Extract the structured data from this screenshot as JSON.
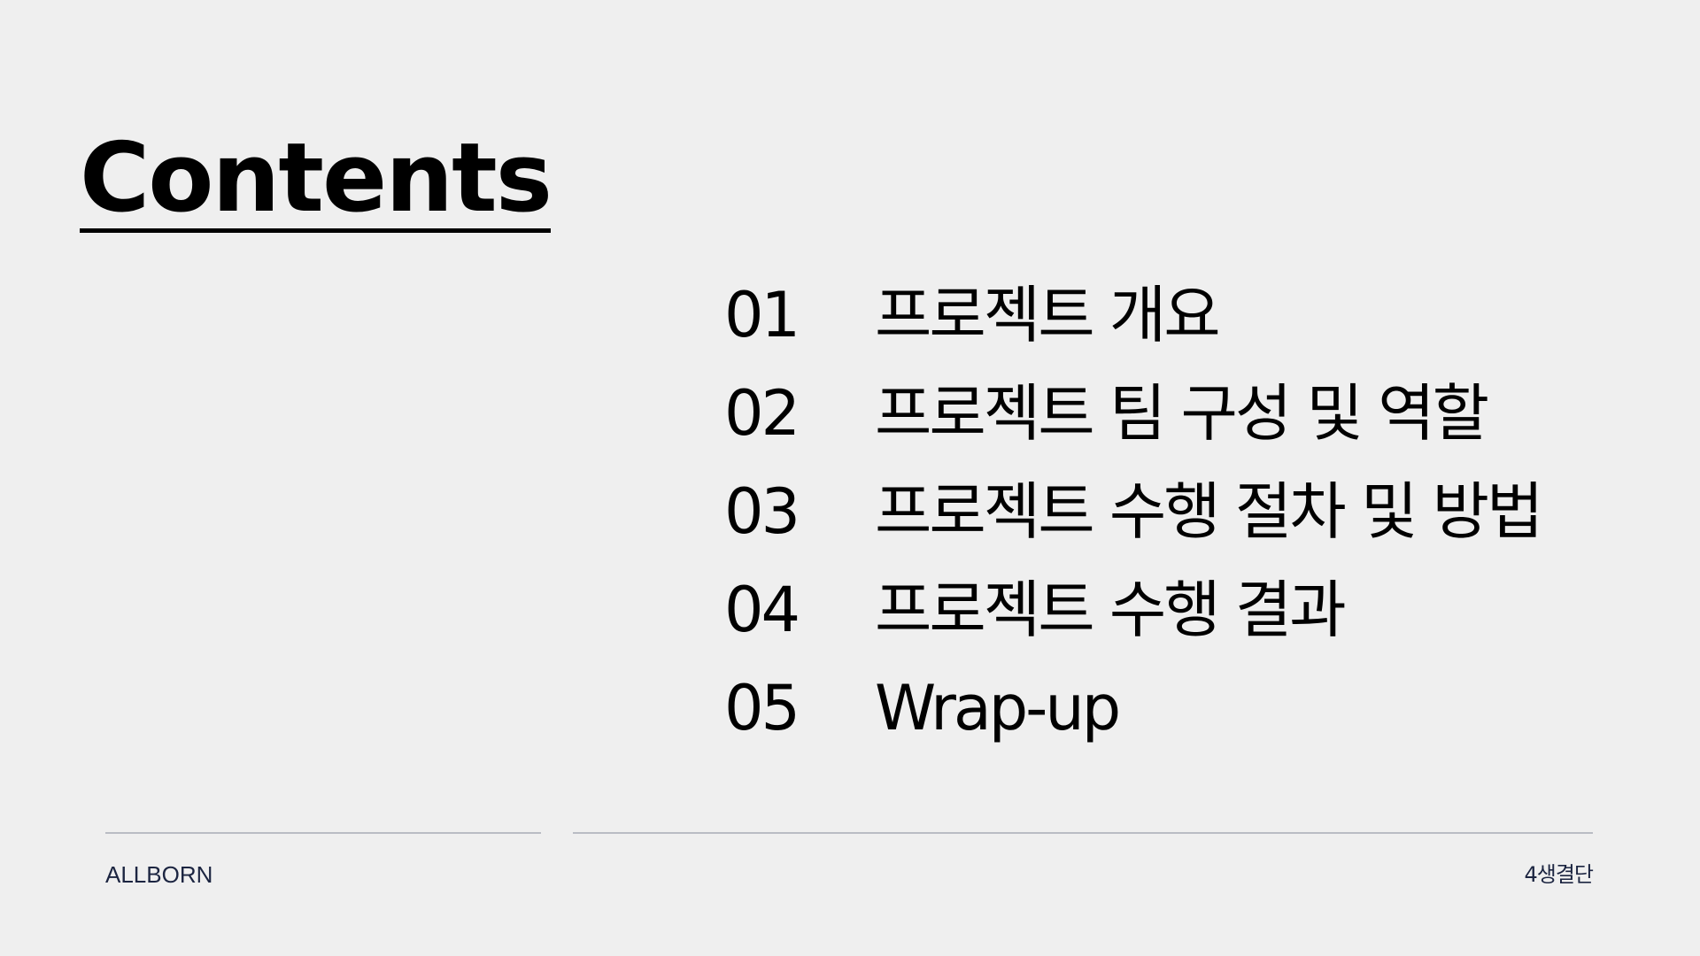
{
  "slide": {
    "title": "Contents",
    "toc": [
      {
        "number": "01",
        "label": "프로젝트 개요"
      },
      {
        "number": "02",
        "label": "프로젝트 팀 구성 및 역할"
      },
      {
        "number": "03",
        "label": "프로젝트 수행 절차 및 방법"
      },
      {
        "number": "04",
        "label": "프로젝트 수행 결과"
      },
      {
        "number": "05",
        "label": "Wrap-up"
      }
    ],
    "footer": {
      "left": "ALLBORN",
      "right": "4생결단"
    }
  },
  "colors": {
    "background": "#efefef",
    "text": "#000000",
    "footer_text": "#1c2541",
    "rule": "#b9bcc4"
  }
}
